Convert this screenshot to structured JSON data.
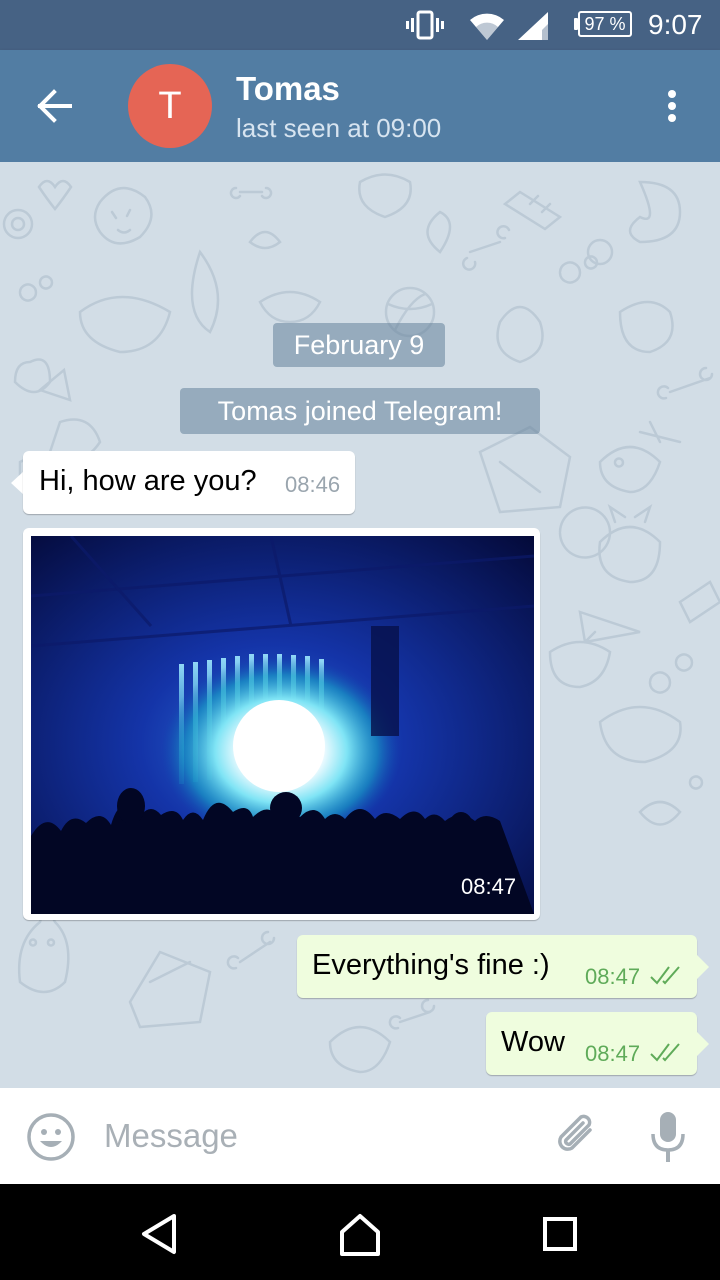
{
  "status_bar": {
    "battery": "97 %",
    "time": "9:07",
    "icons": [
      "vibrate-icon",
      "wifi-icon",
      "signal-icon",
      "battery-icon"
    ]
  },
  "header": {
    "avatar_letter": "T",
    "avatar_color": "#e56555",
    "name": "Tomas",
    "status": "last seen at 09:00",
    "bar_color": "#527da3"
  },
  "chat": {
    "date_label": "February 9",
    "service_message": "Tomas joined Telegram!",
    "messages": [
      {
        "direction": "incoming",
        "text": "Hi, how are you?",
        "time": "08:46"
      },
      {
        "direction": "incoming",
        "type": "photo",
        "time": "08:47"
      },
      {
        "direction": "outgoing",
        "text": "Everything's fine :)",
        "time": "08:47",
        "status": "read"
      },
      {
        "direction": "outgoing",
        "text": "Wow",
        "time": "08:47",
        "status": "read"
      }
    ]
  },
  "input_bar": {
    "placeholder": "Message",
    "value": ""
  },
  "colors": {
    "outgoing_bubble": "#effdde",
    "incoming_bubble": "#ffffff",
    "read_check": "#5fab59",
    "chat_background": "#d2dde6"
  }
}
